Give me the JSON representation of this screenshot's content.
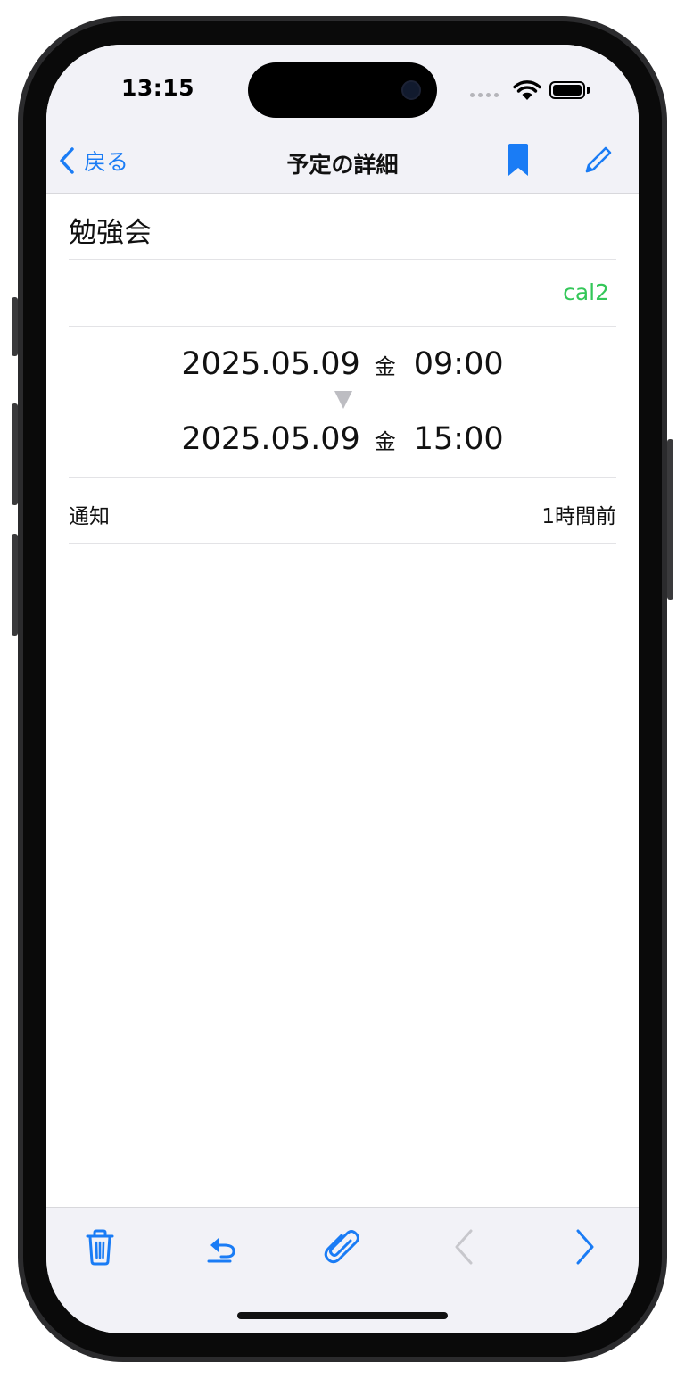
{
  "status_bar": {
    "time": "13:15"
  },
  "nav": {
    "back_label": "戻る",
    "title": "予定の詳細"
  },
  "event": {
    "title": "勉強会",
    "calendar": "cal2",
    "calendar_color": "#34c759",
    "start": {
      "date": "2025.05.09",
      "weekday": "金",
      "time": "09:00"
    },
    "end": {
      "date": "2025.05.09",
      "weekday": "金",
      "time": "15:00"
    },
    "notification_label": "通知",
    "notification_value": "1時間前"
  },
  "toolbar": {
    "icons": [
      "trash-icon",
      "undo-icon",
      "paperclip-icon",
      "chevron-left-icon",
      "chevron-right-icon"
    ]
  },
  "colors": {
    "accent": "#1a7cf5",
    "disabled": "#c7c7cc",
    "bar_background": "#f2f2f7"
  }
}
